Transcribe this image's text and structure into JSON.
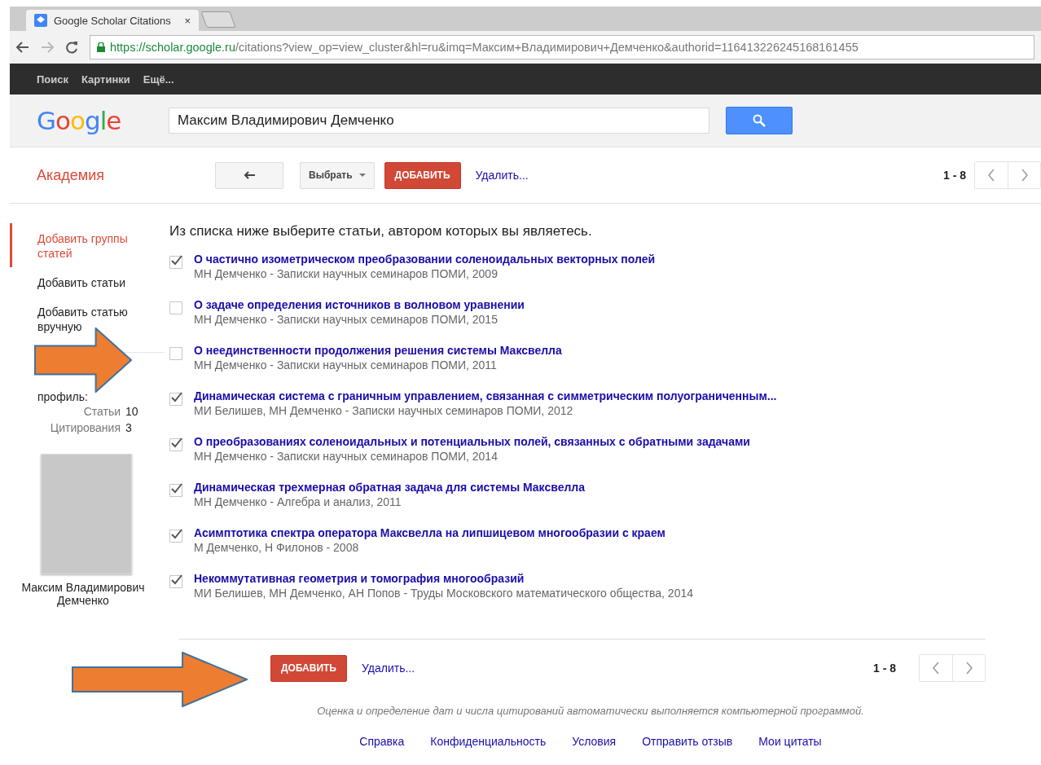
{
  "browser": {
    "tab_title": "Google Scholar Citations",
    "tab_close": "×",
    "url_host": "https://scholar.google.ru",
    "url_path": "/citations?view_op=view_cluster&hl=ru&imq=Максим+Владимирович+Демченко&authorid=116413226245168161455"
  },
  "topbar": {
    "links": [
      "Поиск",
      "Картинки",
      "Ещё..."
    ]
  },
  "logo": "Google",
  "search": {
    "value": "Максим Владимирович Демченко"
  },
  "toolbar": {
    "brand": "Академия",
    "select_label": "Выбрать",
    "add_label": "ДОБАВИТЬ",
    "delete_label": "Удалить...",
    "range": "1 - 8"
  },
  "sidebar": {
    "items": [
      {
        "label": "Добавить группы статей",
        "selected": true
      },
      {
        "label": "Добавить статьи",
        "selected": false
      },
      {
        "label": "Добавить статью вручную",
        "selected": false
      }
    ],
    "profile_label": "профиль:",
    "stats": [
      {
        "label": "Статьи",
        "value": "10"
      },
      {
        "label": "Цитирования",
        "value": "3"
      }
    ],
    "name": "Максим Владимирович Демченко"
  },
  "intro": "Из списка ниже выберите статьи, автором которых вы являетесь.",
  "articles": [
    {
      "title": "О частично изометрическом преобразовании соленоидальных векторных полей",
      "meta": "МН Демченко - Записки научных семинаров ПОМИ, 2009",
      "checked": true
    },
    {
      "title": "О задаче определения источников в волновом уравнении",
      "meta": "МН Демченко - Записки научных семинаров ПОМИ, 2015",
      "checked": false
    },
    {
      "title": "О неединственности продолжения решения системы Максвелла",
      "meta": "МН Демченко - Записки научных семинаров ПОМИ, 2011",
      "checked": false
    },
    {
      "title": "Динамическая система с граничным управлением, связанная с симметрическим полуограниченным...",
      "meta": "МИ Белишев, МН Демченко - Записки научных семинаров ПОМИ, 2012",
      "checked": true
    },
    {
      "title": "О преобразованиях соленоидальных и потенциальных полей, связанных с обратными задачами",
      "meta": "МН Демченко - Записки научных семинаров ПОМИ, 2014",
      "checked": true
    },
    {
      "title": "Динамическая трехмерная обратная задача для системы Максвелла",
      "meta": "МН Демченко - Алгебра и анализ, 2011",
      "checked": true
    },
    {
      "title": "Асимптотика спектра оператора Максвелла на липшицевом многообразии с краем",
      "meta": "М Демченко, Н Филонов - 2008",
      "checked": true
    },
    {
      "title": "Некоммутативная геометрия и томография многообразий",
      "meta": "МИ Белишев, МН Демченко, АН Попов - Труды Московского математического общества, 2014",
      "checked": true
    }
  ],
  "bottom_toolbar": {
    "add_label": "ДОБАВИТЬ",
    "delete_label": "Удалить...",
    "range": "1 - 8"
  },
  "disclaimer": "Оценка и определение дат и числа цитирований автоматически выполняется компьютерной программой.",
  "footer_links": [
    "Справка",
    "Конфиденциальность",
    "Условия",
    "Отправить отзыв",
    "Мои цитаты"
  ]
}
